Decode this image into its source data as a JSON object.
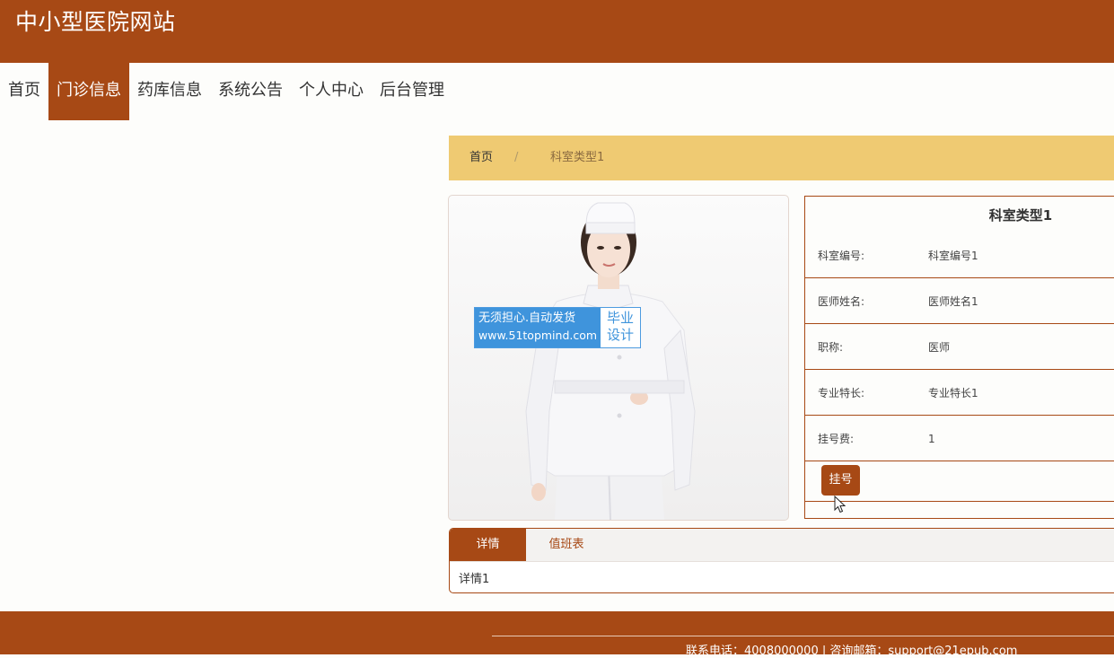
{
  "site": {
    "title": "中小型医院网站"
  },
  "nav": {
    "items": [
      {
        "label": "首页"
      },
      {
        "label": "门诊信息"
      },
      {
        "label": "药库信息"
      },
      {
        "label": "系统公告"
      },
      {
        "label": "个人中心"
      },
      {
        "label": "后台管理"
      }
    ],
    "active": "门诊信息"
  },
  "breadcrumb": {
    "home": "首页",
    "separator": "/",
    "current": "科室类型1"
  },
  "watermark": {
    "line1": "无须担心.自动发货",
    "line2": "www.51topmind.com",
    "right_line1": "毕业",
    "right_line2": "设计"
  },
  "info": {
    "title": "科室类型1",
    "rows": [
      {
        "label": "科室编号:",
        "value": "科室编号1"
      },
      {
        "label": "医师姓名:",
        "value": "医师姓名1"
      },
      {
        "label": "职称:",
        "value": "医师"
      },
      {
        "label": "专业特长:",
        "value": "专业特长1"
      },
      {
        "label": "挂号费:",
        "value": "1"
      }
    ],
    "register_label": "挂号"
  },
  "tabs": {
    "items": [
      {
        "label": "详情"
      },
      {
        "label": "值班表"
      }
    ],
    "active": "详情",
    "content": "详情1"
  },
  "footer": {
    "text": "联系电话：4008000000 | 咨询邮箱：support@21epub.com"
  },
  "colors": {
    "brand": "#a74915",
    "breadcrumb_bg": "#efca72",
    "watermark_blue": "#3f94dc"
  }
}
